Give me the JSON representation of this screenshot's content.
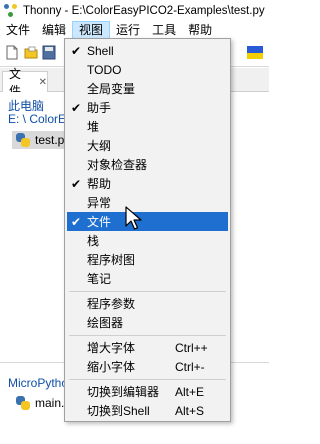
{
  "window": {
    "title": "Thonny  -  E:\\ColorEasyPICO2-Examples\\test.py"
  },
  "menubar": {
    "items": [
      "文件",
      "编辑",
      "视图",
      "运行",
      "工具",
      "帮助"
    ],
    "open_index": 2
  },
  "files_pane": {
    "tab_label": "文件",
    "tab_close": "✕",
    "this_computer_label": "此电脑",
    "path": "E: \\ ColorE",
    "files": [
      "test.py"
    ],
    "device_label": "MicroPytho",
    "device_files": [
      "main.p"
    ]
  },
  "view_menu": {
    "items": [
      {
        "label": "Shell",
        "checked": true
      },
      {
        "label": "TODO",
        "checked": false
      },
      {
        "label": "全局变量",
        "checked": false
      },
      {
        "label": "助手",
        "checked": true
      },
      {
        "label": "堆",
        "checked": false
      },
      {
        "label": "大纲",
        "checked": false
      },
      {
        "label": "对象检查器",
        "checked": false
      },
      {
        "label": "帮助",
        "checked": true
      },
      {
        "label": "异常",
        "checked": false
      },
      {
        "label": "文件",
        "checked": true,
        "highlighted": true
      },
      {
        "label": "栈",
        "checked": false
      },
      {
        "label": "程序树图",
        "checked": false
      },
      {
        "label": "笔记",
        "checked": false
      }
    ],
    "group2": [
      {
        "label": "程序参数"
      },
      {
        "label": "绘图器"
      }
    ],
    "group3": [
      {
        "label": "增大字体",
        "shortcut": "Ctrl++"
      },
      {
        "label": "缩小字体",
        "shortcut": "Ctrl+-"
      }
    ],
    "group4": [
      {
        "label": "切换到编辑器",
        "shortcut": "Alt+E"
      },
      {
        "label": "切换到Shell",
        "shortcut": "Alt+S"
      }
    ],
    "check_glyph": "✔"
  },
  "colors": {
    "highlight": "#1e6fcf",
    "link_blue": "#0f4fa8",
    "menu_bg": "#f2f2f2"
  }
}
